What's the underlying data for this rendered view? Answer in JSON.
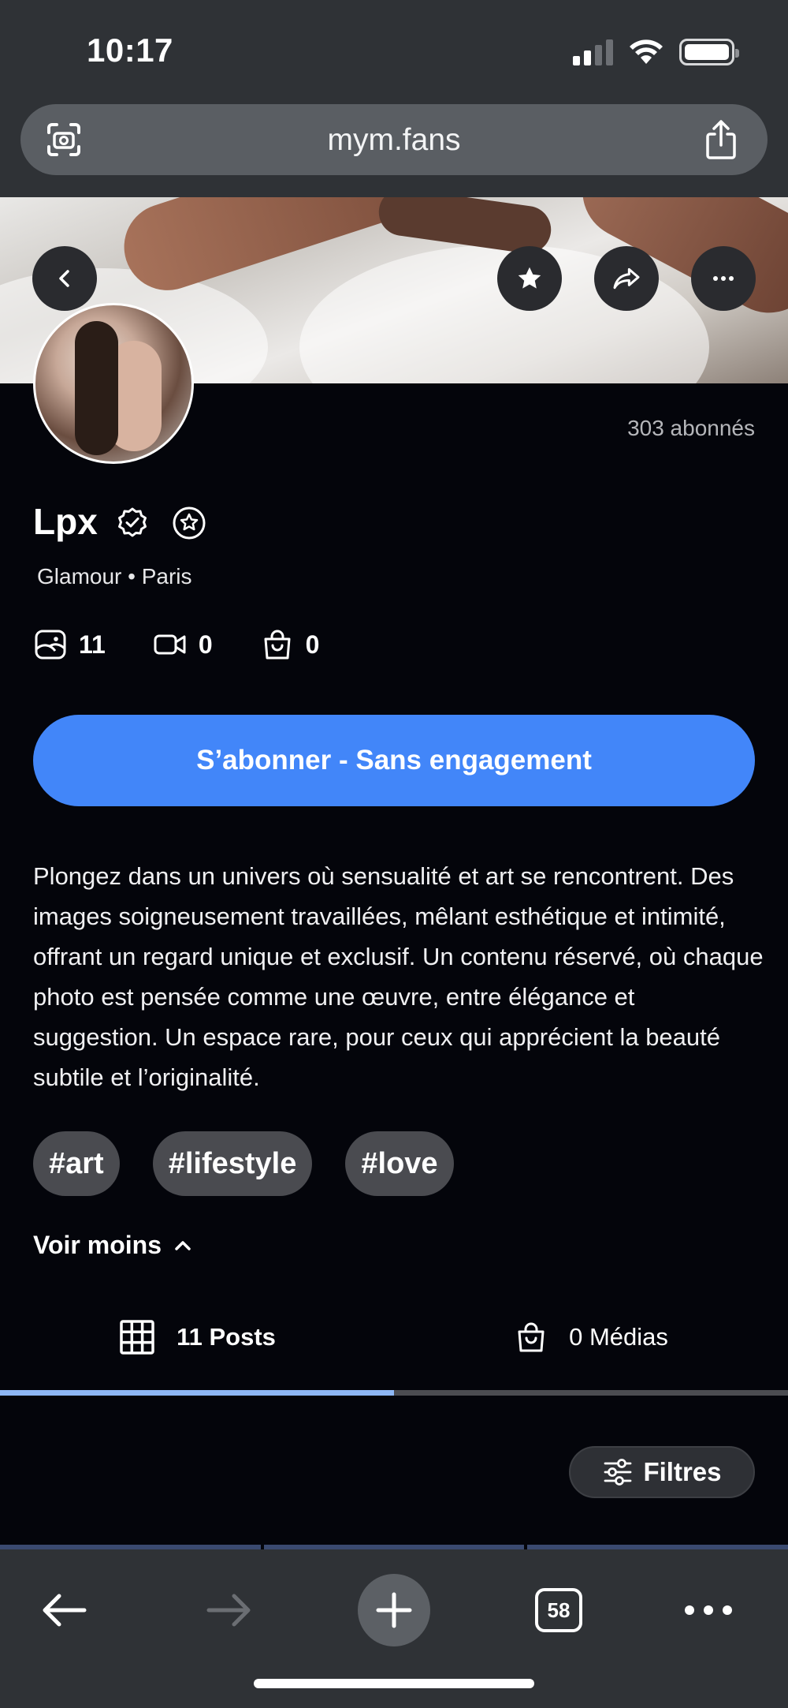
{
  "status_bar": {
    "time": "10:17"
  },
  "browser": {
    "url": "mym.fans",
    "tab_count": "58"
  },
  "profile": {
    "subscribers": "303 abonnés",
    "name": "Lpx",
    "tagline": "Glamour • Paris",
    "stats": {
      "photos": "11",
      "videos": "0",
      "shop": "0"
    },
    "subscribe_label": "S’abonner - Sans engagement",
    "bio": "Plongez dans un univers où sensualité et art se rencontrent. Des images soigneusement travaillées, mêlant esthétique et intimité, offrant un regard unique et exclusif. Un contenu réservé, où chaque photo est pensée comme une œuvre, entre élégance et suggestion. Un espace rare, pour ceux qui apprécient la beauté subtile et l’originalité.",
    "tags": [
      "#art",
      "#lifestyle",
      "#love"
    ],
    "toggle_label": "Voir moins"
  },
  "tabs": {
    "posts": "11 Posts",
    "medias": "0 Médias"
  },
  "filters_label": "Filtres",
  "colors": {
    "accent": "#4286f9",
    "active_tab_line": "#8eb7f4",
    "background": "#04050b",
    "chrome": "#2f3236"
  },
  "icons": {
    "url_left": "camera-scan-icon",
    "url_right": "share-icon",
    "back": "chevron-left-icon",
    "favorite": "star-icon",
    "share": "share-arrow-icon",
    "more": "more-icon",
    "verified": "verified-badge-icon",
    "star_badge": "star-badge-icon",
    "photos": "image-icon",
    "videos": "video-icon",
    "shop": "bag-icon",
    "posts_tab": "grid-icon",
    "medias_tab": "bag-icon",
    "filters": "sliders-icon"
  }
}
